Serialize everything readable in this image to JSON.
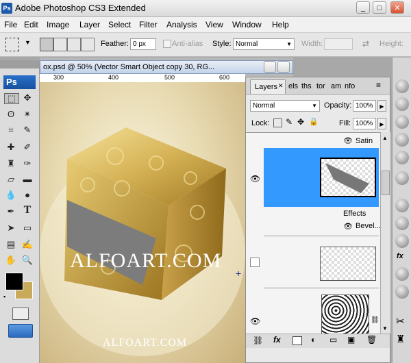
{
  "app": {
    "title": "Adobe Photoshop CS3 Extended",
    "logo": "Ps"
  },
  "window_controls": {
    "minimize": "_",
    "maximize": "□",
    "close": "✕"
  },
  "menu": [
    "File",
    "Edit",
    "Image",
    "Layer",
    "Select",
    "Filter",
    "Analysis",
    "View",
    "Window",
    "Help"
  ],
  "options": {
    "feather_label": "Feather:",
    "feather_value": "0 px",
    "antialias_label": "Anti-alias",
    "style_label": "Style:",
    "style_value": "Normal",
    "width_label": "Width:",
    "height_label": "Height:"
  },
  "tools": {
    "logo": "Ps"
  },
  "document": {
    "title": "ox.psd @ 50% (Vector Smart Object copy 30, RG...",
    "ruler_labels": [
      "300",
      "400",
      "500",
      "600"
    ],
    "watermark_main": "ALFOART.COM",
    "watermark_bottom": "ALFOART.COM"
  },
  "layers_panel": {
    "tabs": [
      "Layers",
      "els",
      "ths",
      "tor",
      "am",
      "nfo"
    ],
    "blend_mode": "Normal",
    "opacity_label": "Opacity:",
    "opacity_value": "100%",
    "lock_label": "Lock:",
    "fill_label": "Fill:",
    "fill_value": "100%",
    "rows": {
      "satin": "Satin",
      "effects": "Effects",
      "bevel": "Bevel..."
    }
  },
  "colors": {
    "accent": "#3399ff",
    "title_bar": "#d9d9d9",
    "ps_blue": "#1d5aa8",
    "gold": "#c9a95a"
  }
}
